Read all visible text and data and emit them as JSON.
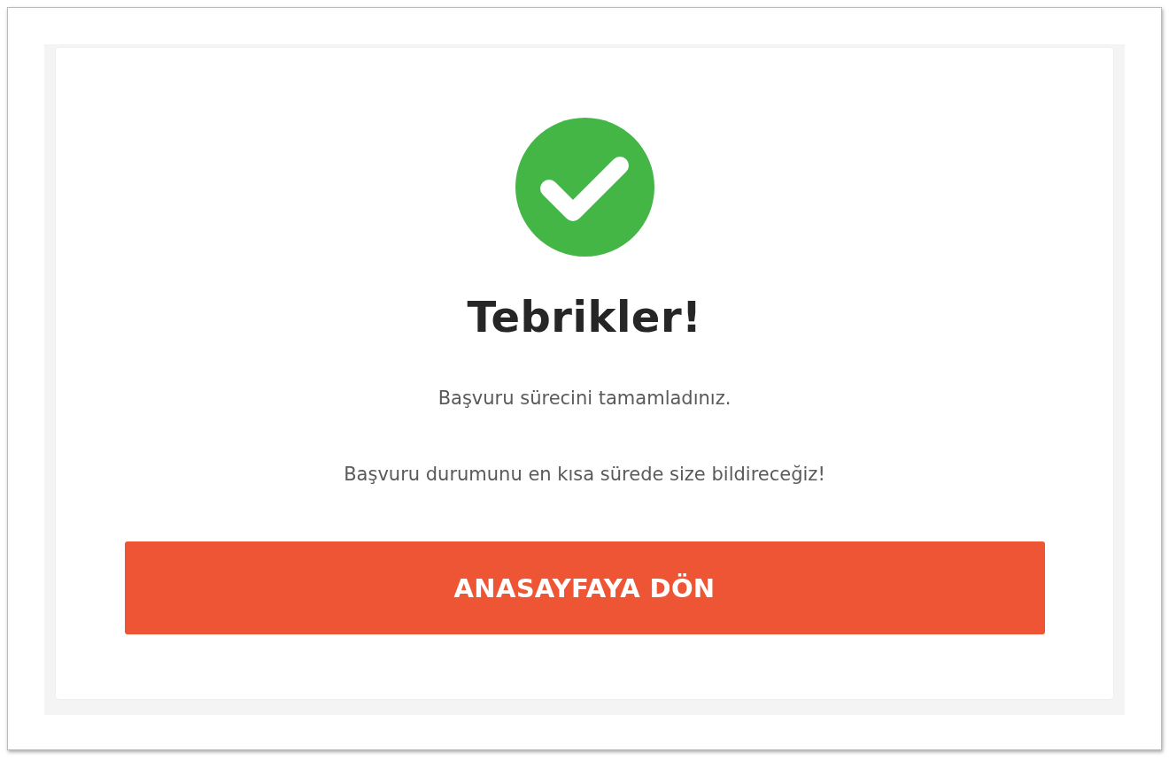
{
  "title": "Tebrikler!",
  "messages": [
    "Başvuru sürecini tamamladınız.",
    "Başvuru durumunu en kısa sürede size bildireceğiz!"
  ],
  "button": {
    "label": "ANASAYFAYA DÖN"
  }
}
